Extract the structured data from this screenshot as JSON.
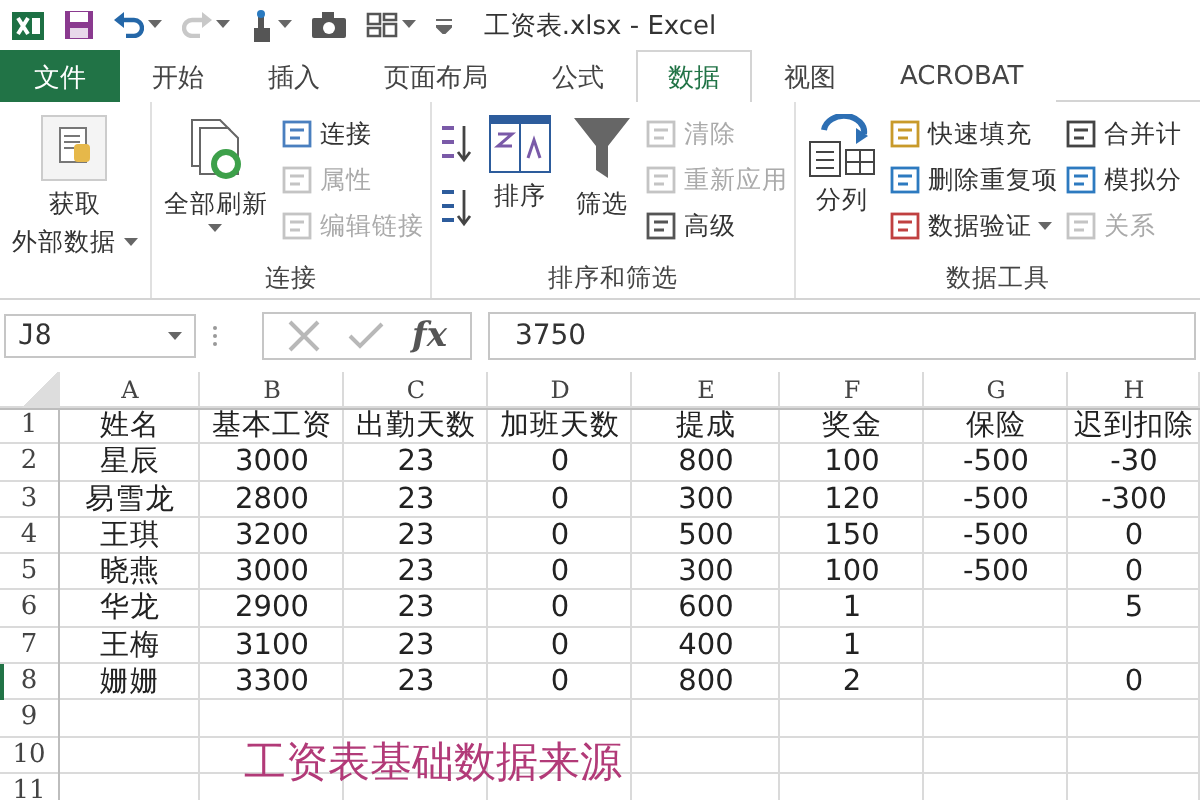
{
  "window": {
    "title": "工资表.xlsx - Excel"
  },
  "quick_access": {
    "undo_dropdown": true,
    "redo_disabled": true
  },
  "tabs": [
    {
      "label": "文件",
      "kind": "file",
      "selected": false
    },
    {
      "label": "开始",
      "kind": "tab",
      "selected": false
    },
    {
      "label": "插入",
      "kind": "tab",
      "selected": false
    },
    {
      "label": "页面布局",
      "kind": "tab",
      "selected": false
    },
    {
      "label": "公式",
      "kind": "tab",
      "selected": false
    },
    {
      "label": "数据",
      "kind": "tab",
      "selected": true
    },
    {
      "label": "视图",
      "kind": "tab",
      "selected": false
    },
    {
      "label": "ACROBAT",
      "kind": "tab",
      "selected": false
    }
  ],
  "ribbon": {
    "groups": [
      {
        "columns": [
          {
            "kind": "large",
            "lines": [
              "获取",
              "外部数据"
            ],
            "dropdown": true
          }
        ]
      },
      {
        "label": "连接",
        "columns": [
          {
            "kind": "large",
            "lines": [
              "全部刷新"
            ],
            "dropdown": true
          },
          {
            "kind": "stack",
            "items": [
              {
                "label": "连接",
                "disabled": false,
                "dropdown": false
              },
              {
                "label": "属性",
                "disabled": true,
                "dropdown": false
              },
              {
                "label": "编辑链接",
                "disabled": true,
                "dropdown": false
              }
            ]
          }
        ]
      },
      {
        "label": "排序和筛选",
        "columns": [
          {
            "kind": "icons"
          },
          {
            "kind": "large",
            "lines": [
              "排序"
            ],
            "dropdown": false
          },
          {
            "kind": "large",
            "lines": [
              "筛选"
            ],
            "dropdown": false
          },
          {
            "kind": "stack",
            "items": [
              {
                "label": "清除",
                "disabled": true,
                "dropdown": false
              },
              {
                "label": "重新应用",
                "disabled": true,
                "dropdown": false
              },
              {
                "label": "高级",
                "disabled": false,
                "dropdown": false
              }
            ]
          }
        ]
      },
      {
        "label": "数据工具",
        "columns": [
          {
            "kind": "large",
            "lines": [
              "分列"
            ],
            "dropdown": false
          },
          {
            "kind": "stack",
            "items": [
              {
                "label": "快速填充",
                "disabled": false,
                "dropdown": false
              },
              {
                "label": "删除重复项",
                "disabled": false,
                "dropdown": false
              },
              {
                "label": "数据验证",
                "disabled": false,
                "dropdown": true
              }
            ]
          },
          {
            "kind": "stack",
            "items": [
              {
                "label": "合并计",
                "disabled": false,
                "dropdown": false
              },
              {
                "label": "模拟分",
                "disabled": false,
                "dropdown": false
              },
              {
                "label": "关系",
                "disabled": true,
                "dropdown": false
              }
            ]
          }
        ]
      }
    ]
  },
  "formula_bar": {
    "name_box": "J8",
    "function_label": "fx",
    "value": "3750"
  },
  "sheet": {
    "columns": [
      "A",
      "B",
      "C",
      "D",
      "E",
      "F",
      "G",
      "H"
    ],
    "rows": [
      {
        "number": "1",
        "active": false,
        "cells": [
          "姓名",
          "基本工资",
          "出勤天数",
          "加班天数",
          "提成",
          "奖金",
          "保险",
          "迟到扣除"
        ]
      },
      {
        "number": "2",
        "active": false,
        "cells": [
          "星辰",
          "3000",
          "23",
          "0",
          "800",
          "100",
          "-500",
          "-30"
        ]
      },
      {
        "number": "3",
        "active": false,
        "cells": [
          "易雪龙",
          "2800",
          "23",
          "0",
          "300",
          "120",
          "-500",
          "-300"
        ]
      },
      {
        "number": "4",
        "active": false,
        "cells": [
          "王琪",
          "3200",
          "23",
          "0",
          "500",
          "150",
          "-500",
          "0"
        ]
      },
      {
        "number": "5",
        "active": false,
        "cells": [
          "晓燕",
          "3000",
          "23",
          "0",
          "300",
          "100",
          "-500",
          "0"
        ]
      },
      {
        "number": "6",
        "active": false,
        "cells": [
          "华龙",
          "2900",
          "23",
          "0",
          "600",
          "1",
          null,
          "5"
        ]
      },
      {
        "number": "7",
        "active": false,
        "cells": [
          "王梅",
          "3100",
          "23",
          "0",
          "400",
          "1",
          null,
          null
        ]
      },
      {
        "number": "8",
        "active": true,
        "cells": [
          "姗姗",
          "3300",
          "23",
          "0",
          "800",
          "2",
          null,
          "0"
        ]
      },
      {
        "number": "9",
        "active": false,
        "cells": []
      },
      {
        "number": "10",
        "active": false,
        "cells": []
      },
      {
        "number": "11",
        "active": false,
        "cells": []
      }
    ],
    "annotation": "工资表基础数据来源"
  }
}
